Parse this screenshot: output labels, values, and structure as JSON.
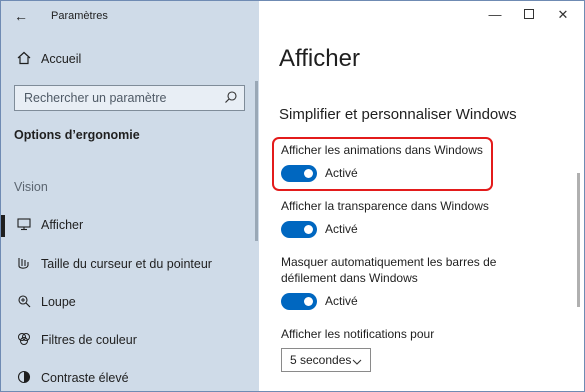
{
  "app": {
    "title": "Paramètres"
  },
  "sidebar": {
    "home_label": "Accueil",
    "search_placeholder": "Rechercher un paramètre",
    "category_title": "Options d’ergonomie",
    "section_label": "Vision",
    "items": [
      {
        "label": "Afficher",
        "icon": "monitor-icon",
        "active": true
      },
      {
        "label": "Taille du curseur et du pointeur",
        "icon": "cursor-icon",
        "active": false
      },
      {
        "label": "Loupe",
        "icon": "magnifier-icon",
        "active": false
      },
      {
        "label": "Filtres de couleur",
        "icon": "color-filter-icon",
        "active": false
      },
      {
        "label": "Contraste élevé",
        "icon": "contrast-icon",
        "active": false
      }
    ]
  },
  "main": {
    "title": "Afficher",
    "subtitle": "Simplifier et personnaliser Windows",
    "settings": [
      {
        "label": "Afficher les animations dans Windows",
        "toggle_text": "Activé",
        "on": true
      },
      {
        "label": "Afficher la transparence dans Windows",
        "toggle_text": "Activé",
        "on": true
      },
      {
        "label": "Masquer automatiquement les barres de défilement dans Windows",
        "toggle_text": "Activé",
        "on": true
      }
    ],
    "notifications_label": "Afficher les notifications pour",
    "notifications_value": "5 secondes"
  },
  "colors": {
    "accent": "#0067c0",
    "highlight": "#e31b1b",
    "sidebar_bg": "#cfdbe8"
  }
}
